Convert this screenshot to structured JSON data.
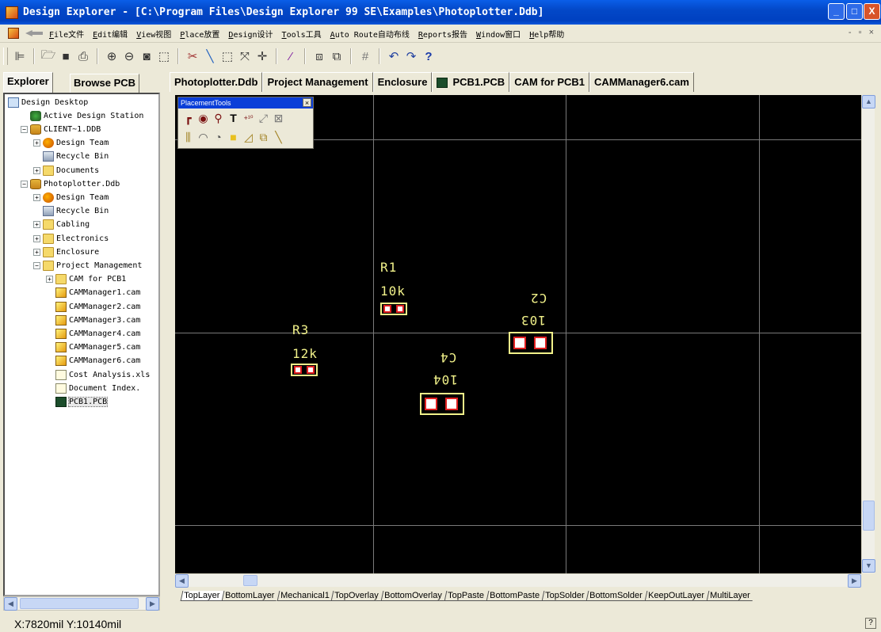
{
  "window": {
    "title": "Design Explorer - [C:\\Program Files\\Design Explorer 99 SE\\Examples\\Photoplotter.Ddb]",
    "minimize": "_",
    "maximize": "□",
    "close": "X",
    "doc_controls": "- ▫ ×"
  },
  "menu": [
    {
      "key": "F",
      "label": "ile文件"
    },
    {
      "key": "E",
      "label": "dit编辑"
    },
    {
      "key": "V",
      "label": "iew视图"
    },
    {
      "key": "P",
      "label": "lace放置"
    },
    {
      "key": "D",
      "label": "esign设计"
    },
    {
      "key": "T",
      "label": "ools工具"
    },
    {
      "key": "A",
      "label": "uto Route自动布线"
    },
    {
      "key": "R",
      "label": "eports报告"
    },
    {
      "key": "W",
      "label": "indow窗口"
    },
    {
      "key": "H",
      "label": "elp帮助"
    }
  ],
  "toolbar": {
    "icons": [
      "project-icon",
      "open-icon",
      "save-icon",
      "print-icon",
      "zoom-in-icon",
      "zoom-out-icon",
      "zoom-fit-icon",
      "zoom-area-icon",
      "cut-wire-icon",
      "line-icon",
      "select-icon",
      "deselect-icon",
      "move-icon",
      "wand-icon",
      "library-icon",
      "browse-icon",
      "grid-icon",
      "undo-icon",
      "redo-icon",
      "help-icon"
    ]
  },
  "left_tabs": [
    "Explorer",
    "Browse PCB"
  ],
  "tree": [
    {
      "label": "Design Desktop",
      "icon": "desk",
      "level": 0,
      "exp": ""
    },
    {
      "label": "Active Design Station",
      "icon": "station",
      "level": 1,
      "exp": ""
    },
    {
      "label": "CLIENT~1.DDB",
      "icon": "db",
      "level": 1,
      "exp": "−"
    },
    {
      "label": "Design Team",
      "icon": "team",
      "level": 2,
      "exp": "+"
    },
    {
      "label": "Recycle Bin",
      "icon": "bin",
      "level": 2,
      "exp": ""
    },
    {
      "label": "Documents",
      "icon": "folder",
      "level": 2,
      "exp": "+"
    },
    {
      "label": "Photoplotter.Ddb",
      "icon": "db",
      "level": 1,
      "exp": "−"
    },
    {
      "label": "Design Team",
      "icon": "team",
      "level": 2,
      "exp": "+"
    },
    {
      "label": "Recycle Bin",
      "icon": "bin",
      "level": 2,
      "exp": ""
    },
    {
      "label": "Cabling",
      "icon": "folder",
      "level": 2,
      "exp": "+"
    },
    {
      "label": "Electronics",
      "icon": "folder",
      "level": 2,
      "exp": "+"
    },
    {
      "label": "Enclosure",
      "icon": "folder",
      "level": 2,
      "exp": "+"
    },
    {
      "label": "Project Management",
      "icon": "folder",
      "level": 2,
      "exp": "−"
    },
    {
      "label": "CAM for PCB1",
      "icon": "folder",
      "level": 3,
      "exp": "+"
    },
    {
      "label": "CAMManager1.cam",
      "icon": "cam",
      "level": 3,
      "exp": ""
    },
    {
      "label": "CAMManager2.cam",
      "icon": "cam",
      "level": 3,
      "exp": ""
    },
    {
      "label": "CAMManager3.cam",
      "icon": "cam",
      "level": 3,
      "exp": ""
    },
    {
      "label": "CAMManager4.cam",
      "icon": "cam",
      "level": 3,
      "exp": ""
    },
    {
      "label": "CAMManager5.cam",
      "icon": "cam",
      "level": 3,
      "exp": ""
    },
    {
      "label": "CAMManager6.cam",
      "icon": "cam",
      "level": 3,
      "exp": ""
    },
    {
      "label": "Cost Analysis.xls",
      "icon": "doc",
      "level": 3,
      "exp": ""
    },
    {
      "label": "Document Index.",
      "icon": "doc",
      "level": 3,
      "exp": ""
    },
    {
      "label": "PCB1.PCB",
      "icon": "pcb",
      "level": 3,
      "exp": ""
    }
  ],
  "doc_tabs": [
    {
      "label": "Photoplotter.Ddb",
      "icon": ""
    },
    {
      "label": "Project Management",
      "icon": ""
    },
    {
      "label": "Enclosure",
      "icon": ""
    },
    {
      "label": "PCB1.PCB",
      "icon": "pcb",
      "active": true
    },
    {
      "label": "CAM for PCB1",
      "icon": ""
    },
    {
      "label": "CAMManager6.cam",
      "icon": ""
    }
  ],
  "placement_tools": {
    "title": "PlacementTools",
    "close": "×",
    "row1": [
      "route-icon",
      "pad-icon",
      "via-icon",
      "string-icon",
      "coordinate-icon",
      "dimension-icon",
      "cross-icon"
    ],
    "row2": [
      "component-icon",
      "arc-center-icon",
      "arc-edge-icon",
      "fill-icon",
      "polygon-icon",
      "split-plane-icon",
      "line-icon"
    ]
  },
  "components": [
    {
      "designator": "R1",
      "value": "10k",
      "mirrored": false
    },
    {
      "designator": "C2",
      "value": "103",
      "mirrored": true
    },
    {
      "designator": "R3",
      "value": "12k",
      "mirrored": false
    },
    {
      "designator": "C4",
      "value": "104",
      "mirrored": true
    }
  ],
  "layers": [
    "TopLayer",
    "BottomLayer",
    "Mechanical1",
    "TopOverlay",
    "BottomOverlay",
    "TopPaste",
    "BottomPaste",
    "TopSolder",
    "BottomSolder",
    "KeepOutLayer",
    "MultiLayer"
  ],
  "status": {
    "coords": "X:7820mil Y:10140mil",
    "help": "?"
  },
  "colors": {
    "silkscreen": "#f2f28a",
    "pad": "#e02020",
    "canvas": "#000000",
    "grid": "#7a7a7a",
    "titlebar": "#0348c8"
  }
}
